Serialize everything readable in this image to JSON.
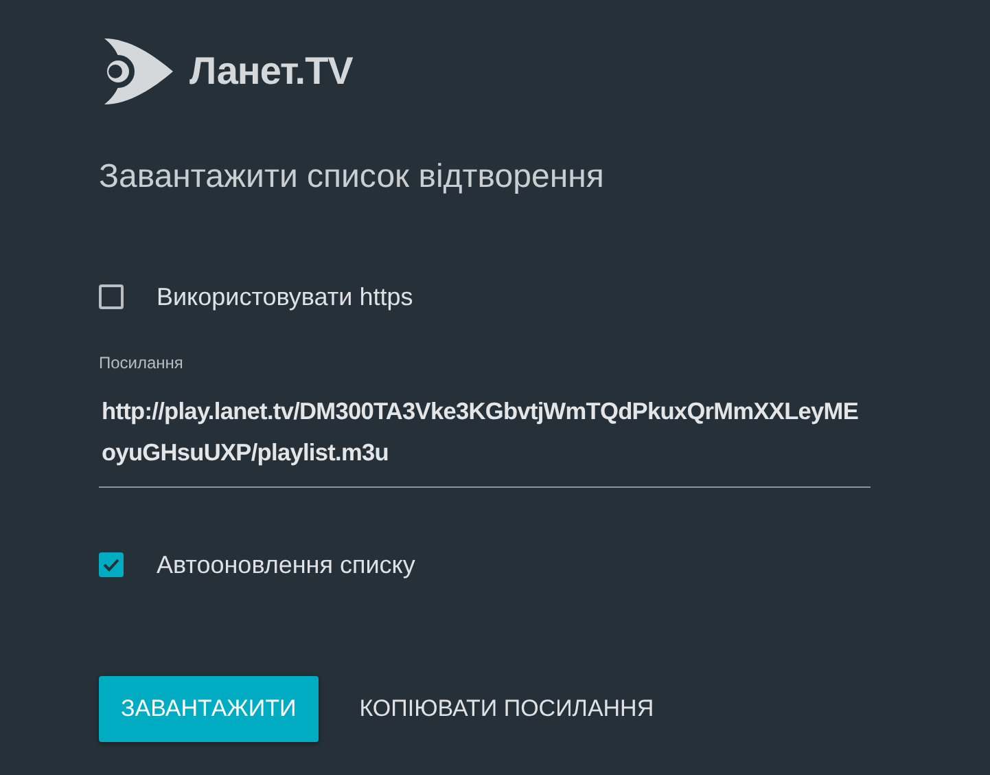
{
  "logo": {
    "text": "Ланет.TV"
  },
  "title": "Завантажити список відтворення",
  "options": [
    {
      "label": "Використовувати https",
      "checked": false
    }
  ],
  "link_field": {
    "label": "Посилання",
    "value": "http://play.lanet.tv/DM300TA3Vke3KGbvtjWmTQdPkuxQrMmXXLeyMEoyuGHsuUXP/playlist.m3u"
  },
  "auto_update": {
    "label": "Автооновлення списку",
    "checked": true
  },
  "buttons": [
    {
      "label": "ЗАВАНТАЖИТИ",
      "kind": "primary"
    },
    {
      "label": "КОПІЮВАТИ ПОСИЛАННЯ",
      "kind": "flat"
    }
  ]
}
